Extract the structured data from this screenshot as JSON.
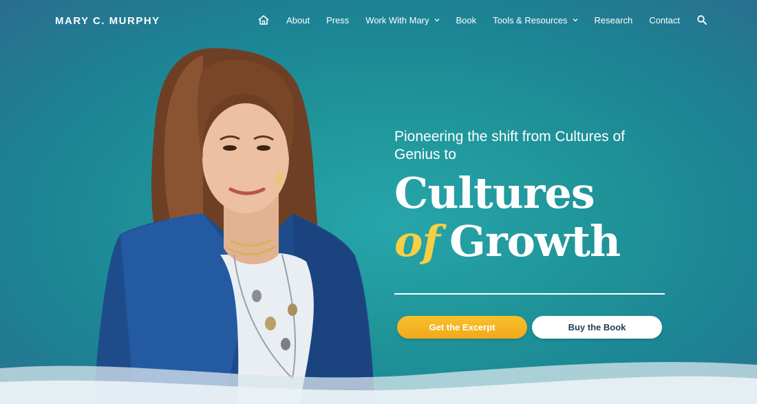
{
  "header": {
    "brand": "MARY C. MURPHY",
    "nav": [
      {
        "label": "About"
      },
      {
        "label": "Press"
      },
      {
        "label": "Work With Mary",
        "has_dropdown": true
      },
      {
        "label": "Book"
      },
      {
        "label": "Tools & Resources",
        "has_dropdown": true
      },
      {
        "label": "Research"
      },
      {
        "label": "Contact"
      }
    ],
    "home_icon": "home-icon",
    "search_icon": "search-icon"
  },
  "hero": {
    "kicker": "Pioneering the shift from Cultures of Genius to",
    "title_line1": "Cultures",
    "title_accent": "of",
    "title_line2": "Growth",
    "cta_primary": "Get the Excerpt",
    "cta_secondary": "Buy the Book"
  },
  "colors": {
    "background": "#1f9599",
    "accent": "#f6cf44",
    "button_primary": "#f4b323",
    "button_secondary_text": "#1f3d55"
  }
}
